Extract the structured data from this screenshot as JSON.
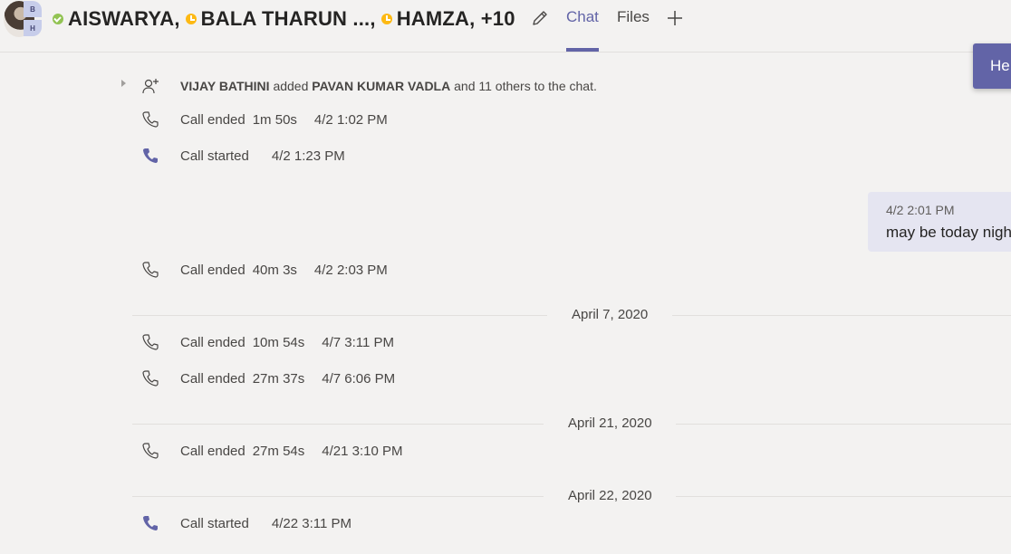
{
  "header": {
    "participants": [
      {
        "name": "AISWARYA,",
        "status": "available"
      },
      {
        "name": "BALA THARUN ...,",
        "status": "away"
      },
      {
        "name": "HAMZA, +10",
        "status": "away"
      }
    ],
    "avatar_initials": [
      "B",
      "H"
    ],
    "tabs": [
      {
        "label": "Chat",
        "active": true
      },
      {
        "label": "Files",
        "active": false
      }
    ],
    "meet_button_label": "He"
  },
  "colors": {
    "accent": "#6264a7",
    "available": "#92c353",
    "away": "#fdb913",
    "bubble": "#e5e5f1"
  },
  "system_message": {
    "actor": "VIJAY BATHINI",
    "verb": "added",
    "target": "PAVAN KUMAR VADLA",
    "rest": "and 11 others to the chat."
  },
  "events": [
    {
      "icon": "phone-outline-icon",
      "label": "Call ended",
      "duration": "1m 50s",
      "time": "4/2 1:02 PM"
    },
    {
      "icon": "phone-filled-icon",
      "label": "Call started",
      "duration": "",
      "time": "4/2 1:23 PM"
    },
    {
      "icon": "phone-outline-icon",
      "label": "Call ended",
      "duration": "40m 3s",
      "time": "4/2 2:03 PM"
    },
    {
      "icon": "phone-outline-icon",
      "label": "Call ended",
      "duration": "10m 54s",
      "time": "4/7 3:11 PM"
    },
    {
      "icon": "phone-outline-icon",
      "label": "Call ended",
      "duration": "27m 37s",
      "time": "4/7 6:06 PM"
    },
    {
      "icon": "phone-outline-icon",
      "label": "Call ended",
      "duration": "27m 54s",
      "time": "4/21 3:10 PM"
    },
    {
      "icon": "phone-filled-icon",
      "label": "Call started",
      "duration": "",
      "time": "4/22 3:11 PM"
    }
  ],
  "date_separators": [
    "April 7, 2020",
    "April 21, 2020",
    "April 22, 2020"
  ],
  "message": {
    "time": "4/2 2:01 PM",
    "text": "may be today night"
  }
}
